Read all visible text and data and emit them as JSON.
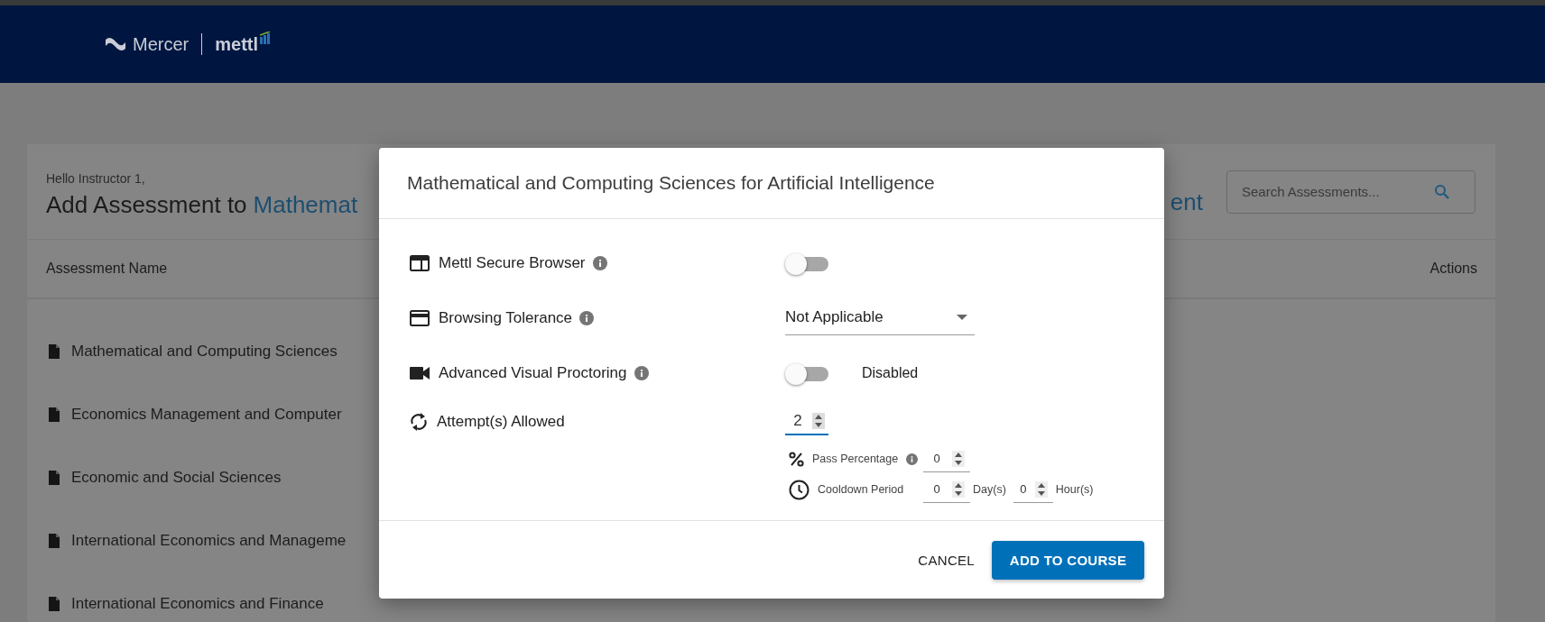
{
  "header": {
    "brand": "Mercer",
    "product": "mettl"
  },
  "page": {
    "greeting": "Hello Instructor 1,",
    "title": "Add Assessment to",
    "course_start": "Mathemat",
    "course_end": "ent",
    "search": {
      "placeholder": "Search Assessments..."
    }
  },
  "table": {
    "columns": [
      "Assessment Name",
      "Actions"
    ],
    "rows": [
      "Mathematical and Computing Sciences",
      "Economics Management and Computer",
      "Economic and Social Sciences",
      "International Economics and Manageme",
      "International Economics and Finance"
    ]
  },
  "dialog": {
    "title": "Mathematical and Computing Sciences for Artificial Intelligence",
    "settings": [
      {
        "kind": "toggle",
        "label": "Mettl Secure Browser",
        "info": true,
        "on": false
      },
      {
        "kind": "select",
        "label": "Browsing Tolerance",
        "info": true,
        "value": "Not Applicable"
      },
      {
        "kind": "toggle",
        "label": "Advanced Visual Proctoring",
        "info": true,
        "on": false,
        "status": "Disabled"
      },
      {
        "kind": "number",
        "label": "Attempt(s) Allowed",
        "info": false,
        "value": "2",
        "focused": true
      }
    ],
    "pass": {
      "label": "Pass Percentage",
      "info": true,
      "value": "0"
    },
    "cooldown": {
      "label": "Cooldown Period",
      "days": "0",
      "days_unit": "Day(s)",
      "hours": "0",
      "hours_unit": "Hour(s)"
    },
    "buttons": [
      {
        "kind": "text",
        "label": "CANCEL"
      },
      {
        "kind": "primary",
        "label": "ADD TO COURSE"
      }
    ]
  }
}
